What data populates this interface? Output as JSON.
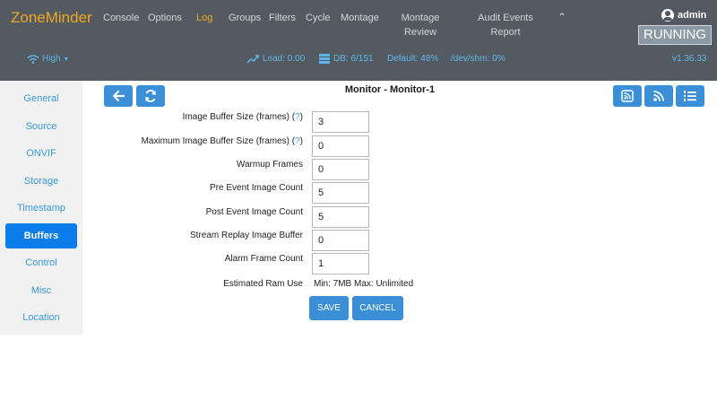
{
  "navbar": {
    "brand": "ZoneMinder",
    "links": [
      {
        "label": "Console"
      },
      {
        "label": "Options"
      },
      {
        "label": "Log"
      },
      {
        "label": "Groups"
      },
      {
        "label": "Filters"
      },
      {
        "label": "Cycle"
      },
      {
        "label": "Montage"
      },
      {
        "label_line1": "Montage",
        "label_line2": "Review"
      },
      {
        "label_line1": "Audit Events",
        "label_line2": "Report"
      }
    ],
    "user": "admin",
    "state": "RUNNING"
  },
  "status": {
    "bandwidth": "High",
    "load": "Load: 0.00",
    "db": "DB: 6/151",
    "default_storage": "Default: 48%",
    "shm": "/dev/shm: 0%",
    "version": "v1.36.33"
  },
  "sidebar": {
    "items": [
      {
        "label": "General"
      },
      {
        "label": "Source"
      },
      {
        "label": "ONVIF"
      },
      {
        "label": "Storage"
      },
      {
        "label": "Timestamp"
      },
      {
        "label": "Buffers"
      },
      {
        "label": "Control"
      },
      {
        "label": "Misc"
      },
      {
        "label": "Location"
      }
    ],
    "active": "Buffers"
  },
  "page": {
    "title": "Monitor - Monitor-1"
  },
  "form": {
    "fields": [
      {
        "label": "Image Buffer Size (frames)",
        "help": "?",
        "value": "3"
      },
      {
        "label": "Maximum Image Buffer Size (frames)",
        "help": "?",
        "value": "0"
      },
      {
        "label": "Warmup Frames",
        "value": "0"
      },
      {
        "label": "Pre Event Image Count",
        "value": "5"
      },
      {
        "label": "Post Event Image Count",
        "value": "5"
      },
      {
        "label": "Stream Replay Image Buffer",
        "value": "0"
      },
      {
        "label": "Alarm Frame Count",
        "value": "1"
      }
    ],
    "ram_label": "Estimated Ram Use",
    "ram_value": "Min: 7MB Max: Unlimited",
    "save_label": "SAVE",
    "cancel_label": "CANCEL"
  },
  "icons": {
    "back": "arrow-left-icon",
    "refresh": "refresh-icon",
    "toolbar_right": [
      "rss-icon",
      "rss-icon",
      "list-icon"
    ]
  },
  "colors": {
    "navbar_bg": "#545a61",
    "brand": "#f0a820",
    "accent": "#3a8fd6",
    "sidebar_active": "#0b7dea",
    "link": "#3a9ad9"
  }
}
